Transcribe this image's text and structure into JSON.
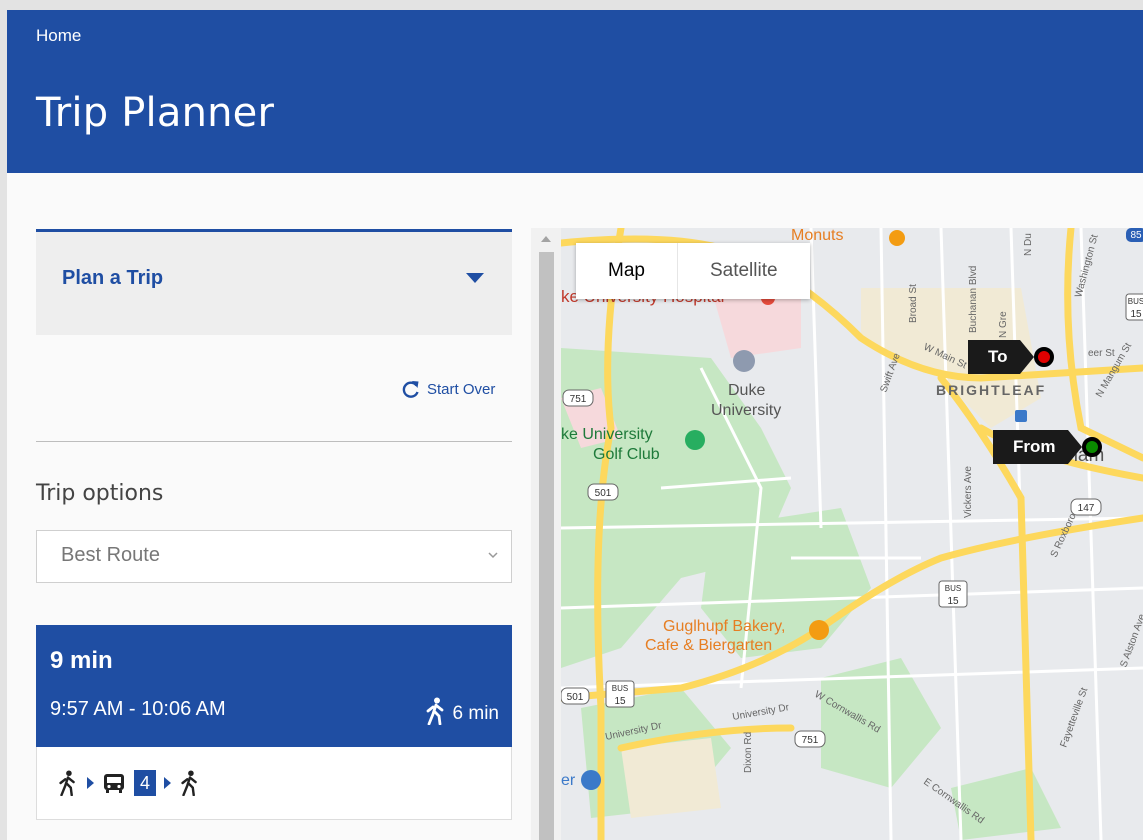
{
  "header": {
    "breadcrumb": "Home",
    "title": "Trip Planner"
  },
  "plan": {
    "label": "Plan a Trip"
  },
  "actions": {
    "start_over": "Start Over"
  },
  "trip_options": {
    "label": "Trip options",
    "selected": "Best Route"
  },
  "result": {
    "duration": "9 min",
    "times": "9:57 AM - 10:06 AM",
    "walk_time": "6 min",
    "route_number": "4"
  },
  "map": {
    "tab_map": "Map",
    "tab_satellite": "Satellite",
    "to_label": "To",
    "from_label": "From",
    "to_color": "#e00000",
    "from_color": "#0a8a00",
    "places": {
      "monuts": "Monuts",
      "hospital": "ke University Hospital",
      "duke": "Duke",
      "university": "University",
      "golf1": "ke University",
      "golf2": "Golf Club",
      "brightleaf": "BRIGHTLEAF",
      "durham": "rham",
      "bakery1": "Guglhupf Bakery,",
      "bakery2": "Cafe & Biergarten",
      "er": "er",
      "w_main": "W Main St",
      "swift": "Swift Ave",
      "broad": "Broad St",
      "buchanan": "Buchanan Blvd",
      "n_gregson": "N Gre",
      "n_duke": "N Du",
      "washington": "Washington St",
      "n_mangum": "N Mangum St",
      "peer": "eer St",
      "vickers": "Vickers Ave",
      "roxboro": "S Roxboro St",
      "alston": "S Alston Ave",
      "fayetteville": "Fayetteville St",
      "w_cornwallis": "W Cornwallis Rd",
      "e_cornwallis": "E Cornwallis Rd",
      "university_dr1": "University Dr",
      "university_dr2": "University Dr",
      "dixon": "Dixon Rd",
      "r751a": "751",
      "r751b": "751",
      "r501a": "501",
      "r501b": "501",
      "r147": "147",
      "r85": "85",
      "bus_text": "BUS",
      "r15": "15"
    }
  }
}
